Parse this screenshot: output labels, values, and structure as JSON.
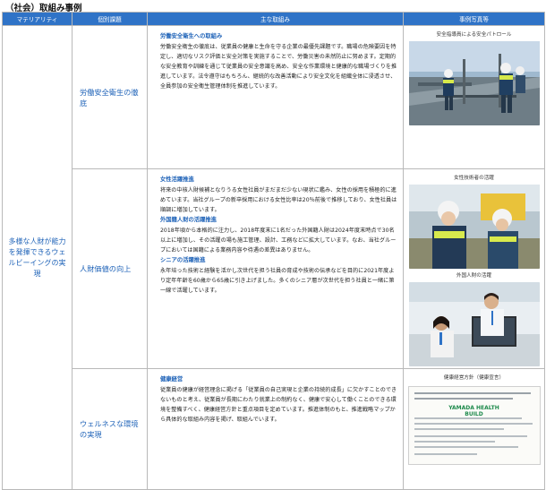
{
  "heading": "（社会）取組み事例",
  "headers": {
    "materiality": "マテリアリティ",
    "issue": "個別課題",
    "main": "主な取組み",
    "photo": "事例写真等"
  },
  "materiality": "多様な人財が能力を発揮できるウェルビーイングの実現",
  "rows": [
    {
      "issue": "労働安全衛生の徹底",
      "sections": [
        {
          "title": "労働安全衛生への取組み",
          "body": "労働安全衛生の徹底は、従業員の健康と生命を守る企業の最優先課題です。職場の危険要因を特定し、適切なリスク評価と安全対策を実施することで、労働災害の未然防止に努めます。定期的な安全教育や訓練を通じて従業員の安全意識を高め、安全な作業環境と健康的な職場づくりを推進しています。法令遵守はもちろん、継続的な改善活動により安全文化を組織全体に浸透させ、全員参加の安全衛生管理体制を推進しています。"
        }
      ],
      "photos": [
        {
          "caption": "安全指導員による安全パトロール"
        }
      ]
    },
    {
      "issue": "人財価値の向上",
      "sections": [
        {
          "title": "女性活躍推進",
          "body": "将来の中核人財候補となりうる女性社員がまだまだ少ない現状に鑑み、女性の採用を積極的に進めています。当社グループの新卒採用における女性比率は20％前後で推移しており、女性社員は順調に増加しています。"
        },
        {
          "title": "外国籍人財の活躍推進",
          "body": "2018年頃から本格的に注力し、2018年度末に1名だった外国籍人財は2024年度末時点で30名以上に増加し、その活躍の場も施工管理、設計、工務などに拡大しています。なお、当社グループにおいては国籍による業務内容や待遇の差異はありません。"
        },
        {
          "title": "シニアの活躍推進",
          "body": "永年培った技術と経験を活かし次世代を担う社員の育成や技術の伝承などを目的に2021年度より定年年齢を60歳から65歳に引き上げました。多くのシニア層が次世代を担う社員と一緒に第一線で活躍しています。"
        }
      ],
      "photos": [
        {
          "caption": "女性技術者の活躍"
        },
        {
          "caption": "外国人財の活躍"
        }
      ]
    },
    {
      "issue": "ウェルネスな環境の実現",
      "sections": [
        {
          "title": "健康経営",
          "body": "従業員の健康が経営理念に掲げる「従業員の自己実現と企業の持続的成長」に欠かすことのできないものと考え、従業員が長期にわたり就業上の制約なく、健康で安心して働くことのできる環境を整備すべく、健康経営方針と重点項目を定めています。推進体制のもと、推進戦略マップから具体的な取組み内容を掲げ、取組んでいます。"
        }
      ],
      "photos": [
        {
          "caption": "健康経営方針（健康宣言）",
          "banner": "YAMADA HEALTH BUILD"
        }
      ]
    }
  ]
}
